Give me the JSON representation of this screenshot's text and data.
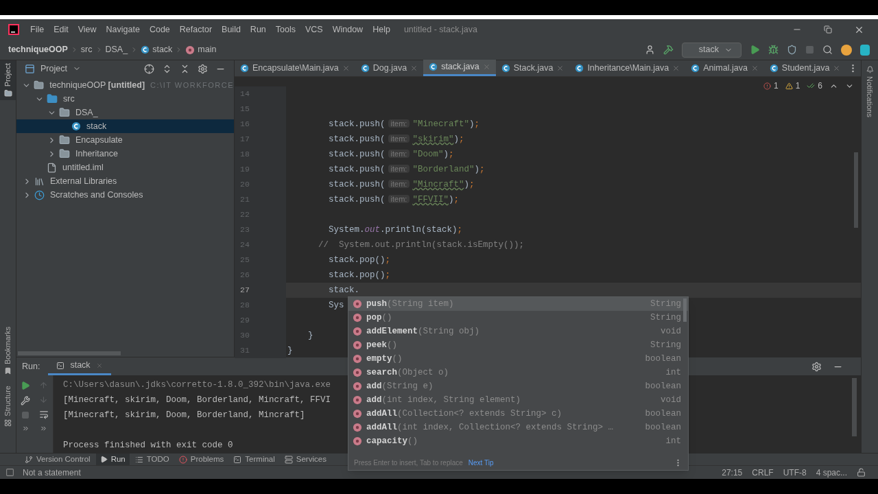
{
  "window": {
    "title": "untitled - stack.java"
  },
  "menu": [
    "File",
    "Edit",
    "View",
    "Navigate",
    "Code",
    "Refactor",
    "Build",
    "Run",
    "Tools",
    "VCS",
    "Window",
    "Help"
  ],
  "breadcrumbs": [
    {
      "kind": "project",
      "label": "techniqueOOP"
    },
    {
      "kind": "folder",
      "label": "src"
    },
    {
      "kind": "folder",
      "label": "DSA_"
    },
    {
      "kind": "class",
      "label": "stack"
    },
    {
      "kind": "method",
      "label": "main"
    }
  ],
  "run_config": "stack",
  "left_tools": {
    "top": "Project",
    "bottom": [
      "Bookmarks",
      "Structure"
    ]
  },
  "right_tools": [
    "Notifications"
  ],
  "project_panel": {
    "title": "Project",
    "tree": [
      {
        "kind": "module",
        "label": "techniqueOOP **[untitled]**",
        "path": "C:\\IT WORKFORCE",
        "expanded": true,
        "selected": false,
        "children": [
          {
            "kind": "source",
            "label": "src",
            "expanded": true,
            "selected": false,
            "children": [
              {
                "kind": "package",
                "label": "DSA_",
                "expanded": true,
                "selected": false,
                "children": [
                  {
                    "kind": "class",
                    "label": "stack",
                    "selected": true
                  }
                ]
              },
              {
                "kind": "package",
                "label": "Encapsulate",
                "expanded": false,
                "selected": false
              },
              {
                "kind": "package",
                "label": "Inheritance",
                "expanded": false,
                "selected": false
              }
            ]
          },
          {
            "kind": "file",
            "label": "untitled.iml",
            "selected": false
          }
        ]
      },
      {
        "kind": "libraries",
        "label": "External Libraries",
        "expanded": false,
        "selected": false
      },
      {
        "kind": "scratches",
        "label": "Scratches and Consoles",
        "expanded": false,
        "selected": false
      }
    ]
  },
  "editor_tabs": [
    {
      "label": "Encapsulate\\Main.java",
      "selected": false
    },
    {
      "label": "Dog.java",
      "selected": false
    },
    {
      "label": "stack.java",
      "selected": true
    },
    {
      "label": "Stack.java",
      "selected": false
    },
    {
      "label": "Inheritance\\Main.java",
      "selected": false
    },
    {
      "label": "Animal.java",
      "selected": false
    },
    {
      "label": "Student.java",
      "selected": false
    }
  ],
  "inspections": {
    "errors": "1",
    "warnings": "1",
    "ok": "6"
  },
  "code_lines": [
    {
      "number": "14",
      "current": false
    },
    {
      "number": "15",
      "current": false
    },
    {
      "number": "16",
      "current": false,
      "tokens": [
        {
          "kind": "code",
          "text": "        stack.push("
        },
        {
          "kind": "hint",
          "text": "item:"
        },
        {
          "kind": "string",
          "text": "\"Minecraft\"",
          "typo": false
        },
        {
          "kind": "code",
          "text": ")"
        },
        {
          "kind": "punct",
          "text": ";"
        }
      ]
    },
    {
      "number": "17",
      "current": false,
      "tokens": [
        {
          "kind": "code",
          "text": "        stack.push("
        },
        {
          "kind": "hint",
          "text": "item:"
        },
        {
          "kind": "string",
          "text": "\"skirim\"",
          "typo": true
        },
        {
          "kind": "code",
          "text": ")"
        },
        {
          "kind": "punct",
          "text": ";"
        }
      ]
    },
    {
      "number": "18",
      "current": false,
      "tokens": [
        {
          "kind": "code",
          "text": "        stack.push("
        },
        {
          "kind": "hint",
          "text": "item:"
        },
        {
          "kind": "string",
          "text": "\"Doom\"",
          "typo": false
        },
        {
          "kind": "code",
          "text": ")"
        },
        {
          "kind": "punct",
          "text": ";"
        }
      ]
    },
    {
      "number": "19",
      "current": false,
      "tokens": [
        {
          "kind": "code",
          "text": "        stack.push("
        },
        {
          "kind": "hint",
          "text": "item:"
        },
        {
          "kind": "string",
          "text": "\"Borderland\"",
          "typo": false
        },
        {
          "kind": "code",
          "text": ")"
        },
        {
          "kind": "punct",
          "text": ";"
        }
      ]
    },
    {
      "number": "20",
      "current": false,
      "tokens": [
        {
          "kind": "code",
          "text": "        stack.push("
        },
        {
          "kind": "hint",
          "text": "item:"
        },
        {
          "kind": "string",
          "text": "\"Mincraft\"",
          "typo": true
        },
        {
          "kind": "code",
          "text": ")"
        },
        {
          "kind": "punct",
          "text": ";"
        }
      ]
    },
    {
      "number": "21",
      "current": false,
      "tokens": [
        {
          "kind": "code",
          "text": "        stack.push("
        },
        {
          "kind": "hint",
          "text": "item:"
        },
        {
          "kind": "string",
          "text": "\"FFVII\"",
          "typo": true
        },
        {
          "kind": "code",
          "text": ")"
        },
        {
          "kind": "punct",
          "text": ";"
        }
      ]
    },
    {
      "number": "22",
      "current": false
    },
    {
      "number": "23",
      "current": false,
      "tokens": [
        {
          "kind": "code",
          "text": "        System."
        },
        {
          "kind": "field",
          "text": "out"
        },
        {
          "kind": "code",
          "text": ".println(stack)"
        },
        {
          "kind": "punct",
          "text": ";"
        }
      ]
    },
    {
      "number": "24",
      "current": false,
      "tokens": [
        {
          "kind": "comment",
          "text": "      //  System.out.println(stack.isEmpty());"
        }
      ]
    },
    {
      "number": "25",
      "current": false,
      "tokens": [
        {
          "kind": "code",
          "text": "        stack.pop()"
        },
        {
          "kind": "punct",
          "text": ";"
        }
      ]
    },
    {
      "number": "26",
      "current": false,
      "tokens": [
        {
          "kind": "code",
          "text": "        stack.pop()"
        },
        {
          "kind": "punct",
          "text": ";"
        }
      ]
    },
    {
      "number": "27",
      "current": true,
      "tokens": [
        {
          "kind": "code",
          "text": "        stack."
        }
      ]
    },
    {
      "number": "28",
      "current": false,
      "tokens": [
        {
          "kind": "code",
          "text": "        Sys"
        }
      ]
    },
    {
      "number": "29",
      "current": false
    },
    {
      "number": "30",
      "current": false,
      "tokens": [
        {
          "kind": "code",
          "text": "    }"
        }
      ]
    },
    {
      "number": "31",
      "current": false,
      "tokens": [
        {
          "kind": "code",
          "text": "}"
        }
      ]
    }
  ],
  "completion": {
    "items": [
      {
        "name": "push",
        "params": "(String item)",
        "type": "String",
        "selected": true
      },
      {
        "name": "pop",
        "params": "()",
        "type": "String",
        "selected": false
      },
      {
        "name": "addElement",
        "params": "(String obj)",
        "type": "void",
        "selected": false
      },
      {
        "name": "peek",
        "params": "()",
        "type": "String",
        "selected": false
      },
      {
        "name": "empty",
        "params": "()",
        "type": "boolean",
        "selected": false
      },
      {
        "name": "search",
        "params": "(Object o)",
        "type": "int",
        "selected": false
      },
      {
        "name": "add",
        "params": "(String e)",
        "type": "boolean",
        "selected": false
      },
      {
        "name": "add",
        "params": "(int index, String element)",
        "type": "void",
        "selected": false
      },
      {
        "name": "addAll",
        "params": "(Collection<? extends String> c)",
        "type": "boolean",
        "selected": false
      },
      {
        "name": "addAll",
        "params": "(int index, Collection<? extends String> …",
        "type": "boolean",
        "selected": false
      },
      {
        "name": "capacity",
        "params": "()",
        "type": "int",
        "selected": false
      }
    ],
    "hint": "Press Enter to insert, Tab to replace",
    "link": "Next Tip"
  },
  "run_panel": {
    "label": "Run:",
    "tab": "stack",
    "output": [
      {
        "kind": "command",
        "text": "C:\\Users\\dasun\\.jdks\\corretto-1.8.0_392\\bin\\java.exe"
      },
      {
        "kind": "stdout",
        "text": "[Minecraft, skirim, Doom, Borderland, Mincraft, FFVI"
      },
      {
        "kind": "stdout",
        "text": "[Minecraft, skirim, Doom, Borderland, Mincraft]"
      },
      {
        "kind": "blank"
      },
      {
        "kind": "stdout",
        "text": "Process finished with exit code 0"
      }
    ]
  },
  "tool_tabs": [
    {
      "kind": "vcs",
      "label": "Version Control",
      "selected": false
    },
    {
      "kind": "run",
      "label": "Run",
      "selected": true
    },
    {
      "kind": "todo",
      "label": "TODO",
      "selected": false
    },
    {
      "kind": "problems",
      "label": "Problems",
      "selected": false
    },
    {
      "kind": "terminal",
      "label": "Terminal",
      "selected": false
    },
    {
      "kind": "services",
      "label": "Services",
      "selected": false
    }
  ],
  "status": {
    "message": "Not a statement",
    "position": "27:15",
    "line_separator": "CRLF",
    "encoding": "UTF-8",
    "indent": "4 spac..."
  }
}
